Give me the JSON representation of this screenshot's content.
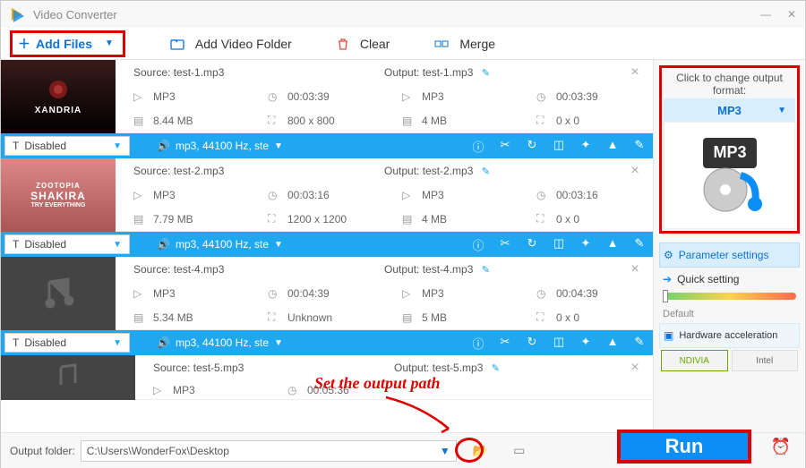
{
  "window": {
    "title": "Video Converter"
  },
  "toolbar": {
    "add_files": "Add Files",
    "add_folder": "Add Video Folder",
    "clear": "Clear",
    "merge": "Merge"
  },
  "tracks": {
    "disabled_label": "Disabled",
    "audio_info": "mp3, 44100 Hz, ste"
  },
  "items": [
    {
      "thumb_label": "XANDRIA",
      "src": "Source: test-1.mp3",
      "out": "Output: test-1.mp3",
      "fmt": "MP3",
      "dur": "00:03:39",
      "size": "8.44 MB",
      "dim": "800 x 800",
      "out_fmt": "MP3",
      "out_dur": "00:03:39",
      "out_size": "4 MB",
      "out_dim": "0 x 0"
    },
    {
      "thumb_label": "ZOOTOPIA SHAKIRA",
      "thumb_sub": "TRY EVERYTHING",
      "src": "Source: test-2.mp3",
      "out": "Output: test-2.mp3",
      "fmt": "MP3",
      "dur": "00:03:16",
      "size": "7.79 MB",
      "dim": "1200 x 1200",
      "out_fmt": "MP3",
      "out_dur": "00:03:16",
      "out_size": "4 MB",
      "out_dim": "0 x 0"
    },
    {
      "thumb_label": "",
      "src": "Source: test-4.mp3",
      "out": "Output: test-4.mp3",
      "fmt": "MP3",
      "dur": "00:04:39",
      "size": "5.34 MB",
      "dim": "Unknown",
      "out_fmt": "MP3",
      "out_dur": "00:04:39",
      "out_size": "5 MB",
      "out_dim": "0 x 0"
    },
    {
      "thumb_label": "",
      "src": "Source: test-5.mp3",
      "out": "Output: test-5.mp3",
      "fmt": "MP3",
      "dur": "00:05:36"
    }
  ],
  "right": {
    "change_label": "Click to change output format:",
    "format": "MP3",
    "param": "Parameter settings",
    "quick": "Quick setting",
    "defaultlbl": "Default",
    "hw": "Hardware acceleration",
    "chip1": "NDIVIA",
    "chip2": "Intel"
  },
  "bottom": {
    "label": "Output folder:",
    "path": "C:\\Users\\WonderFox\\Desktop",
    "run": "Run"
  },
  "annotation": {
    "set_path": "Set the output path"
  }
}
